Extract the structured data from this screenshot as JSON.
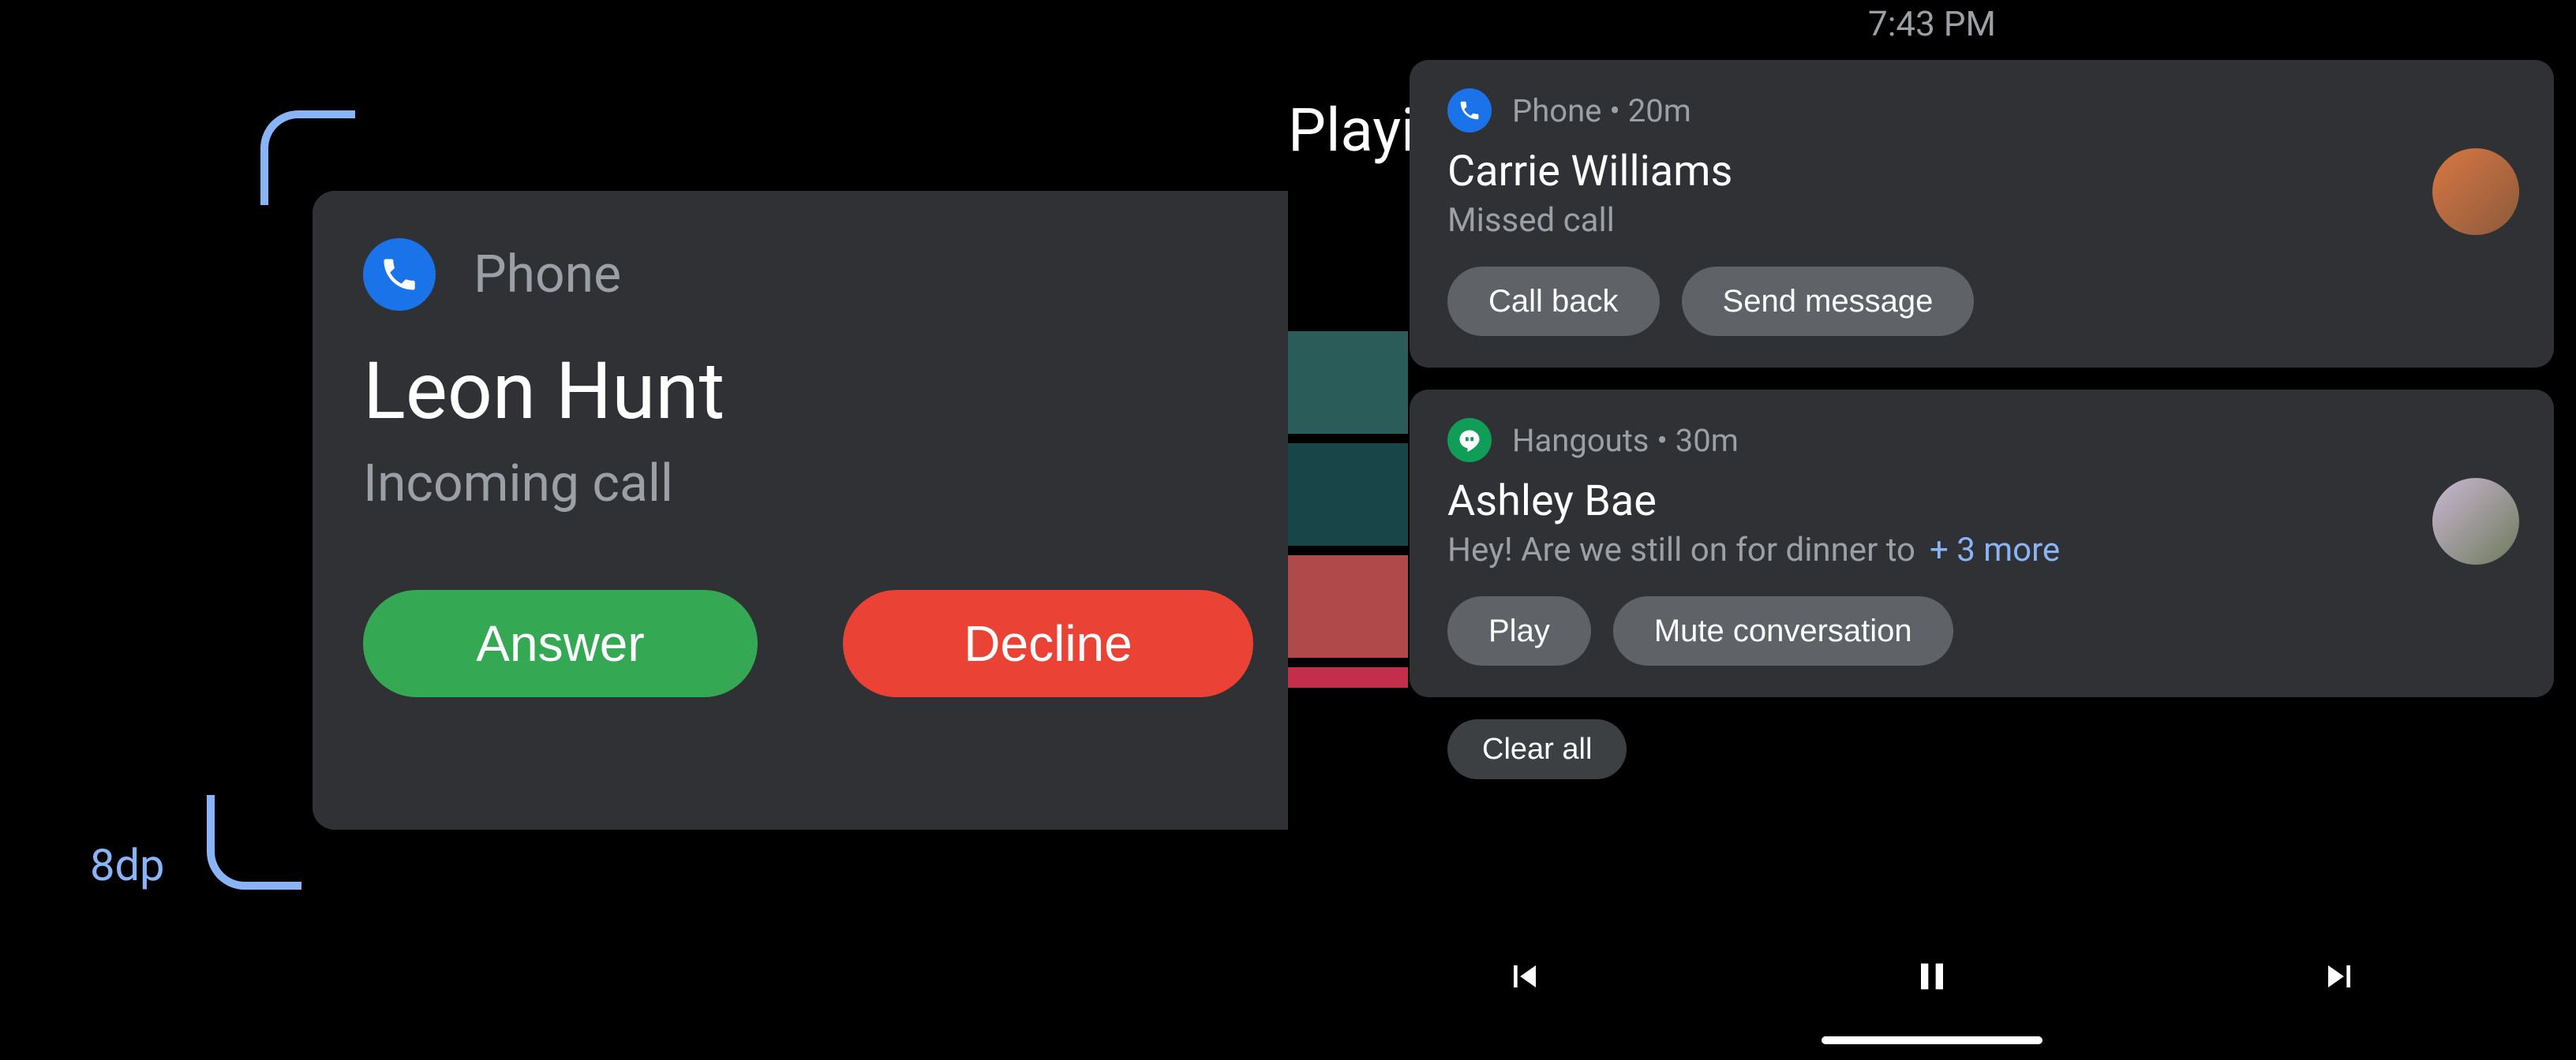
{
  "left": {
    "dp_label": "8dp",
    "app_name": "Phone",
    "caller": "Leon Hunt",
    "subtitle": "Incoming call",
    "answer": "Answer",
    "decline": "Decline"
  },
  "right": {
    "time": "7:43 PM",
    "bg_text": "Playi",
    "clear_all": "Clear all",
    "notifs": [
      {
        "app": "Phone",
        "age": "20m",
        "title": "Carrie Williams",
        "subtitle": "Missed call",
        "more": "",
        "actions": [
          "Call back",
          "Send message"
        ],
        "icon": "phone"
      },
      {
        "app": "Hangouts",
        "age": "30m",
        "title": "Ashley Bae",
        "subtitle": "Hey! Are we still on for dinner to",
        "more": "+ 3 more",
        "actions": [
          "Play",
          "Mute conversation"
        ],
        "icon": "hangouts"
      }
    ]
  }
}
